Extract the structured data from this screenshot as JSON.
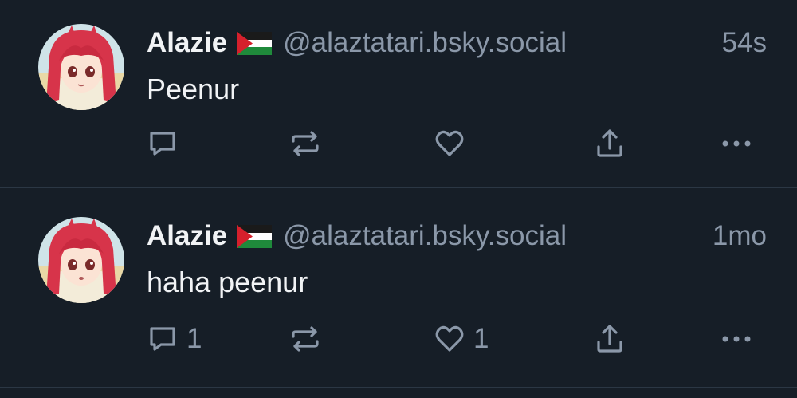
{
  "posts": [
    {
      "author_name": "Alazie",
      "author_flag": "palestine-flag",
      "author_handle": "@alaztatari.bsky.social",
      "time": "54s",
      "text": "Peenur",
      "reply_count": "",
      "like_count": ""
    },
    {
      "author_name": "Alazie",
      "author_flag": "palestine-flag",
      "author_handle": "@alaztatari.bsky.social",
      "time": "1mo",
      "text": "haha peenur",
      "reply_count": "1",
      "like_count": "1"
    }
  ],
  "colors": {
    "background": "#161e27",
    "text_primary": "#f1f3f5",
    "text_secondary": "#8b98a9",
    "divider": "#2b3744"
  },
  "icons": [
    "reply-icon",
    "repost-icon",
    "like-icon",
    "share-icon",
    "more-icon"
  ]
}
